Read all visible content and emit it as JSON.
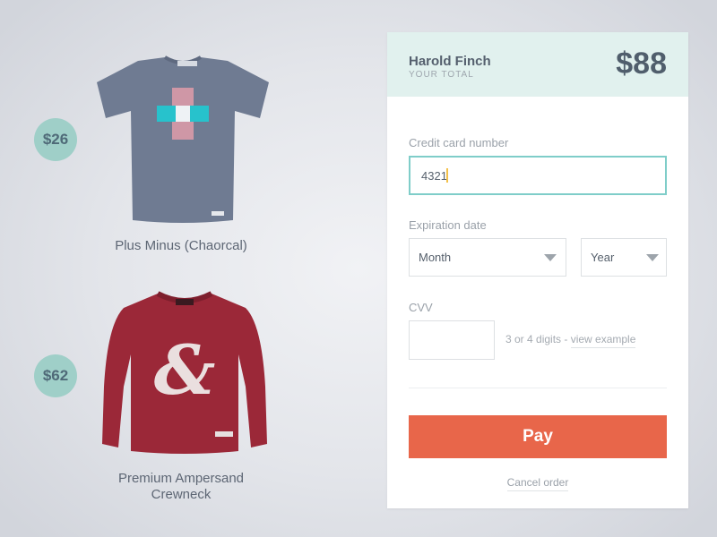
{
  "products": [
    {
      "name": "Plus Minus (Chaorcal)",
      "price": "$26",
      "image": "gray-tshirt-with-cross"
    },
    {
      "name_lines": [
        "Premium Ampersand",
        "Crewneck"
      ],
      "price": "$62",
      "image": "maroon-sweatshirt-with-ampersand"
    }
  ],
  "checkout": {
    "customer_name": "Harold Finch",
    "total_caption": "YOUR TOTAL",
    "total": "$88",
    "card_number": {
      "label": "Credit card number",
      "value": "4321"
    },
    "expiration": {
      "label": "Expiration date",
      "month": "Month",
      "year": "Year"
    },
    "cvv": {
      "label": "CVV",
      "value": "",
      "hint": "3 or 4 digits - ",
      "hint_link": "view example"
    },
    "pay_label": "Pay",
    "cancel_label": "Cancel order"
  },
  "colors": {
    "accent": "#9fcfc8",
    "header_bg": "#e1f1ee",
    "pay_button": "#e8664a",
    "focus_border": "#7fcdc9"
  }
}
